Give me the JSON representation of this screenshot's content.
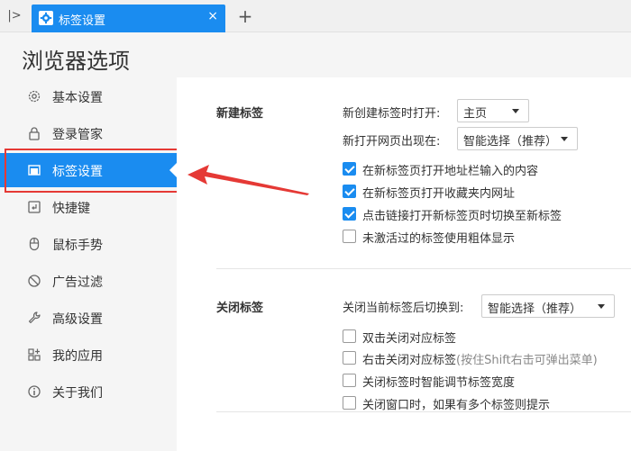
{
  "tabbar": {
    "tab_title": "标签设置",
    "close_glyph": "×",
    "new_tab_glyph": "+",
    "sidebar_toggle_glyph": "|>"
  },
  "page": {
    "title": "浏览器选项"
  },
  "sidebar": {
    "items": [
      {
        "label": "基本设置",
        "icon": "gear-icon"
      },
      {
        "label": "登录管家",
        "icon": "lock-icon"
      },
      {
        "label": "标签设置",
        "icon": "tab-icon",
        "active": true
      },
      {
        "label": "快捷键",
        "icon": "keyboard-icon"
      },
      {
        "label": "鼠标手势",
        "icon": "mouse-icon"
      },
      {
        "label": "广告过滤",
        "icon": "block-icon"
      },
      {
        "label": "高级设置",
        "icon": "wrench-icon"
      },
      {
        "label": "我的应用",
        "icon": "apps-icon"
      },
      {
        "label": "关于我们",
        "icon": "info-icon"
      }
    ]
  },
  "new_tab_section": {
    "title": "新建标签",
    "open_label": "新创建标签时打开:",
    "open_value": "主页",
    "page_label": "新打开网页出现在:",
    "page_value": "智能选择（推荐）",
    "options": [
      {
        "label": "在新标签页打开地址栏输入的内容",
        "checked": true
      },
      {
        "label": "在新标签页打开收藏夹内网址",
        "checked": true
      },
      {
        "label": "点击链接打开新标签页时切换至新标签",
        "checked": true
      },
      {
        "label": "未激活过的标签使用粗体显示",
        "checked": false
      }
    ]
  },
  "close_tab_section": {
    "title": "关闭标签",
    "switch_label": "关闭当前标签后切换到:",
    "switch_value": "智能选择（推荐）",
    "options": [
      {
        "label": "双击关闭对应标签",
        "checked": false
      },
      {
        "label": "右击关闭对应标签",
        "hint": "(按住Shift右击可弹出菜单)",
        "checked": false
      },
      {
        "label": "关闭标签时智能调节标签宽度",
        "checked": false
      },
      {
        "label": "关闭窗口时，如果有多个标签则提示",
        "checked": false
      }
    ]
  },
  "colors": {
    "accent": "#1a8cf0",
    "annotation": "#e53935"
  }
}
